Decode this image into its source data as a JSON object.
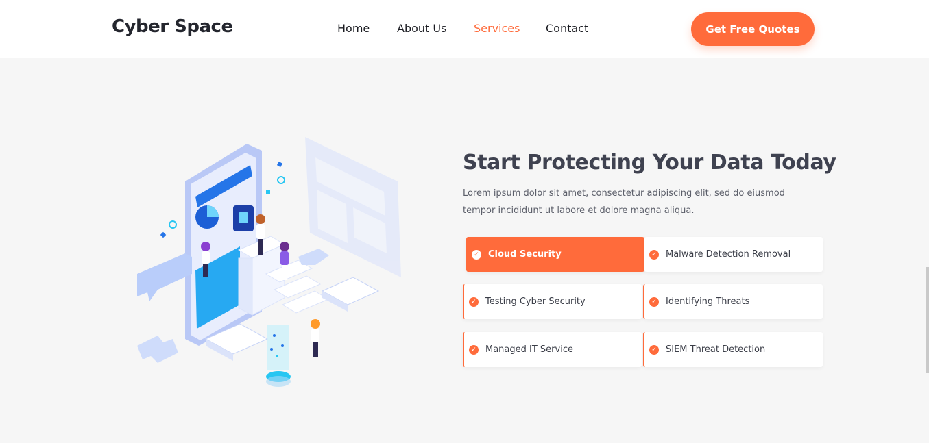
{
  "header": {
    "logo": "Cyber Space",
    "nav": [
      "Home",
      "About Us",
      "Services",
      "Contact"
    ],
    "active_nav": "Services",
    "cta_label": "Get Free Quotes"
  },
  "hero": {
    "title": "Start Protecting Your Data Today",
    "description": "Lorem ipsum dolor sit amet, consectetur adipiscing elit, sed do eiusmod tempor incididunt ut labore et dolore magna aliqua."
  },
  "services": [
    {
      "label": "Cloud Security",
      "selected": true
    },
    {
      "label": "Malware Detection Removal",
      "selected": false
    },
    {
      "label": "Testing Cyber Security",
      "selected": false
    },
    {
      "label": "Identifying Threats",
      "selected": false
    },
    {
      "label": "Managed IT Service",
      "selected": false
    },
    {
      "label": "SIEM Threat Detection",
      "selected": false
    }
  ],
  "icons": {
    "service_check": "check-circle-icon"
  },
  "colors": {
    "accent": "#ff6b3b",
    "heading": "#3f4250",
    "background": "#f6f6f6"
  }
}
